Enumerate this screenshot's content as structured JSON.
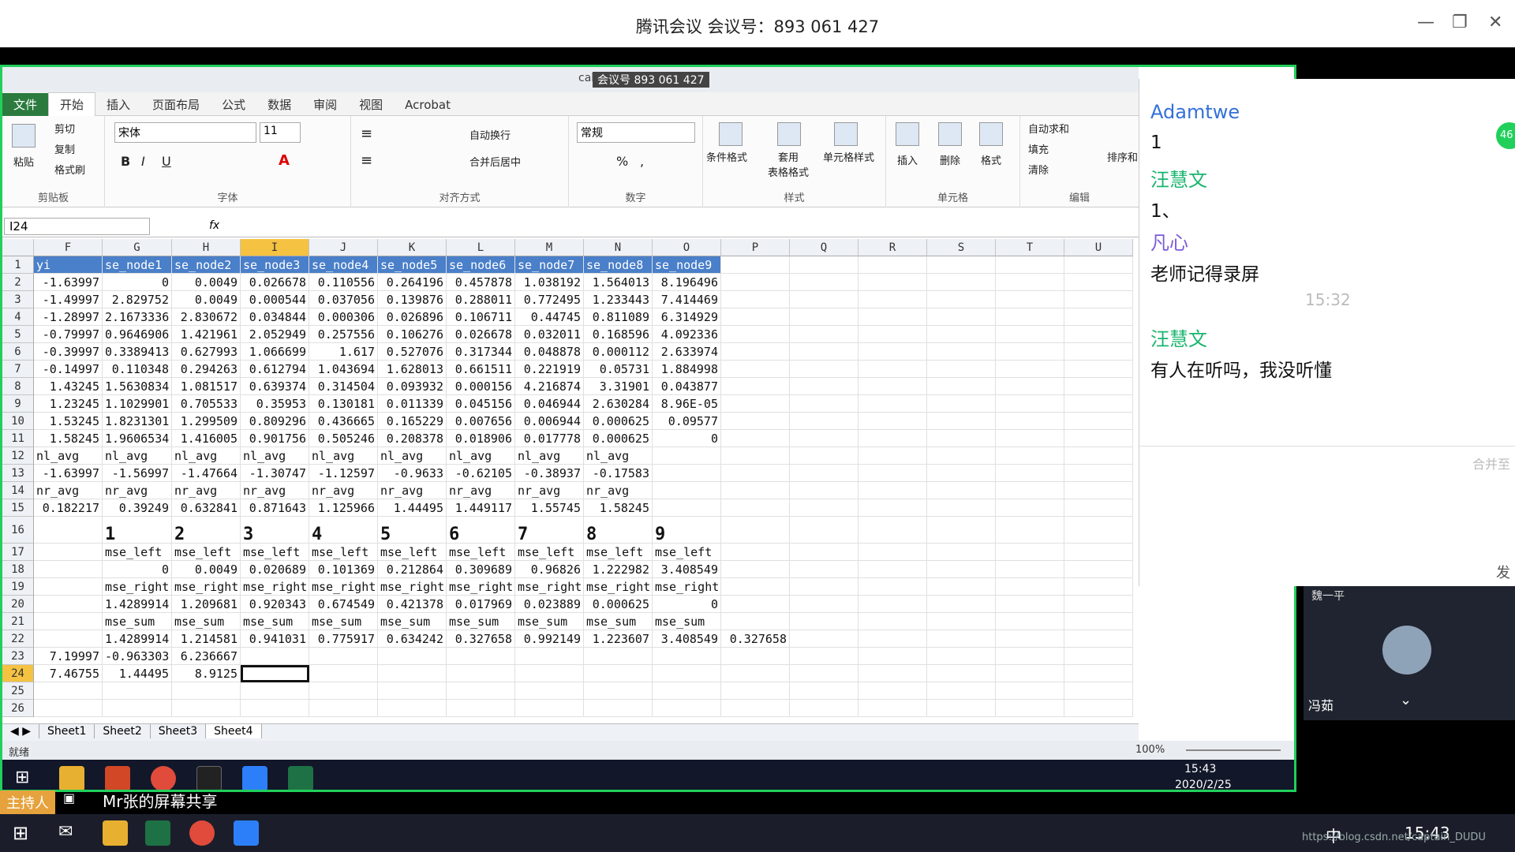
{
  "meeting": {
    "title": "腾讯会议 会议号：893 061 427",
    "minimize": "—",
    "restore": "❐",
    "close": "✕"
  },
  "excel": {
    "title_overlay": "会议号 893 061 427",
    "file_fragment": "cal...el",
    "tabs": [
      "文件",
      "开始",
      "插入",
      "页面布局",
      "公式",
      "数据",
      "审阅",
      "视图",
      "Acrobat"
    ],
    "clipboard": {
      "paste": "粘贴",
      "cut": "剪切",
      "copy": "复制",
      "format_painter": "格式刷",
      "label": "剪贴板"
    },
    "font": {
      "name": "宋体",
      "size": "11",
      "label": "字体",
      "bold": "B",
      "italic": "I",
      "underline": "U"
    },
    "align": {
      "wrap": "自动换行",
      "merge": "合并后居中",
      "label": "对齐方式"
    },
    "number": {
      "format": "常规",
      "label": "数字",
      "percent": "%",
      "comma": ","
    },
    "styles": {
      "cond": "条件格式",
      "table": "套用\n表格格式",
      "cell": "单元格样式",
      "label": "样式"
    },
    "cells": {
      "insert": "插入",
      "delete": "删除",
      "format": "格式",
      "label": "单元格"
    },
    "editing": {
      "autosum": "自动求和",
      "fill": "填充",
      "clear": "清除",
      "sort": "排序和",
      "label": "编辑"
    },
    "namebox": "I24",
    "fx": "fx",
    "columns": [
      "F",
      "G",
      "H",
      "I",
      "J",
      "K",
      "L",
      "M",
      "N",
      "O",
      "P",
      "Q",
      "R",
      "S",
      "T",
      "U"
    ],
    "rows": [
      [
        "yi",
        "se_node1",
        "se_node2",
        "se_node3",
        "se_node4",
        "se_node5",
        "se_node6",
        "se_node7",
        "se_node8",
        "se_node9"
      ],
      [
        "-1.63997",
        "0",
        "0.0049",
        "0.026678",
        "0.110556",
        "0.264196",
        "0.457878",
        "1.038192",
        "1.564013",
        "8.196496"
      ],
      [
        "-1.49997",
        "2.829752",
        "0.0049",
        "0.000544",
        "0.037056",
        "0.139876",
        "0.288011",
        "0.772495",
        "1.233443",
        "7.414469"
      ],
      [
        "-1.28997",
        "2.1673336",
        "2.830672",
        "0.034844",
        "0.000306",
        "0.026896",
        "0.106711",
        "0.44745",
        "0.811089",
        "6.314929"
      ],
      [
        "-0.79997",
        "0.9646906",
        "1.421961",
        "2.052949",
        "0.257556",
        "0.106276",
        "0.026678",
        "0.032011",
        "0.168596",
        "4.092336"
      ],
      [
        "-0.39997",
        "0.3389413",
        "0.627993",
        "1.066699",
        "1.617",
        "0.527076",
        "0.317344",
        "0.048878",
        "0.000112",
        "2.633974"
      ],
      [
        "-0.14997",
        "0.110348",
        "0.294263",
        "0.612794",
        "1.043694",
        "1.628013",
        "0.661511",
        "0.221919",
        "0.05731",
        "1.884998"
      ],
      [
        "1.43245",
        "1.5630834",
        "1.081517",
        "0.639374",
        "0.314504",
        "0.093932",
        "0.000156",
        "4.216874",
        "3.31901",
        "0.043877"
      ],
      [
        "1.23245",
        "1.1029901",
        "0.705533",
        "0.35953",
        "0.130181",
        "0.011339",
        "0.045156",
        "0.046944",
        "2.630284",
        "8.96E-05"
      ],
      [
        "1.53245",
        "1.8231301",
        "1.299509",
        "0.809296",
        "0.436665",
        "0.165229",
        "0.007656",
        "0.006944",
        "0.000625",
        "0.09577"
      ],
      [
        "1.58245",
        "1.9606534",
        "1.416005",
        "0.901756",
        "0.505246",
        "0.208378",
        "0.018906",
        "0.017778",
        "0.000625",
        "0"
      ],
      [
        "nl_avg",
        "nl_avg",
        "nl_avg",
        "nl_avg",
        "nl_avg",
        "nl_avg",
        "nl_avg",
        "nl_avg",
        "nl_avg",
        ""
      ],
      [
        "-1.63997",
        "-1.56997",
        "-1.47664",
        "-1.30747",
        "-1.12597",
        "-0.9633",
        "-0.62105",
        "-0.38937",
        "-0.17583",
        ""
      ],
      [
        "nr_avg",
        "nr_avg",
        "nr_avg",
        "nr_avg",
        "nr_avg",
        "nr_avg",
        "nr_avg",
        "nr_avg",
        "nr_avg",
        ""
      ],
      [
        "0.182217",
        "0.39249",
        "0.632841",
        "0.871643",
        "1.125966",
        "1.44495",
        "1.449117",
        "1.55745",
        "1.58245",
        ""
      ],
      [
        "",
        "1",
        "2",
        "3",
        "4",
        "5",
        "6",
        "7",
        "8",
        "9"
      ],
      [
        "",
        "mse_left",
        "mse_left",
        "mse_left",
        "mse_left",
        "mse_left",
        "mse_left",
        "mse_left",
        "mse_left",
        "mse_left"
      ],
      [
        "",
        "0",
        "0.0049",
        "0.020689",
        "0.101369",
        "0.212864",
        "0.309689",
        "0.96826",
        "1.222982",
        "3.408549"
      ],
      [
        "",
        "mse_right",
        "mse_right",
        "mse_right",
        "mse_right",
        "mse_right",
        "mse_right",
        "mse_right",
        "mse_right",
        "mse_right"
      ],
      [
        "",
        "1.4289914",
        "1.209681",
        "0.920343",
        "0.674549",
        "0.421378",
        "0.017969",
        "0.023889",
        "0.000625",
        "0"
      ],
      [
        "",
        "mse_sum",
        "mse_sum",
        "mse_sum",
        "mse_sum",
        "mse_sum",
        "mse_sum",
        "mse_sum",
        "mse_sum",
        "mse_sum"
      ],
      [
        "",
        "1.4289914",
        "1.214581",
        "0.941031",
        "0.775917",
        "0.634242",
        "0.327658",
        "0.992149",
        "1.223607",
        "3.408549",
        "0.327658"
      ],
      [
        "7.19997",
        "-0.963303",
        "6.236667",
        "",
        "",
        "",
        "",
        "",
        "",
        ""
      ],
      [
        "7.46755",
        "1.44495",
        "8.9125",
        "",
        "",
        "",
        "",
        "",
        "",
        ""
      ],
      [
        "",
        "",
        "",
        "",
        "",
        "",
        "",
        "",
        "",
        ""
      ],
      [
        "",
        "",
        "",
        "",
        "",
        "",
        "",
        "",
        "",
        ""
      ]
    ],
    "sheets": [
      "Sheet1",
      "Sheet2",
      "Sheet3",
      "Sheet4"
    ],
    "status": "就绪",
    "zoom": "100%",
    "clock_time": "15:43",
    "clock_date": "2020/2/25"
  },
  "chat": {
    "messages": [
      {
        "name": "Adamtwe",
        "text": "1",
        "color": "#3370d8"
      },
      {
        "name": "汪慧文",
        "text": "1、",
        "color": "#19b56f"
      },
      {
        "name": "凡心",
        "text": "老师记得录屏",
        "color": "#7a5ad8"
      },
      {
        "time": "15:32"
      },
      {
        "name": "汪慧文",
        "text": "有人在听吗，我没听懂",
        "color": "#19b56f"
      }
    ],
    "merge_label": "合并至",
    "send_label": "发",
    "badge": "46"
  },
  "video": {
    "name": "冯茹",
    "top_name": "魏一平"
  },
  "host": {
    "badge": "主持人",
    "share_text": "Mr张的屏幕共享"
  },
  "taskbar": {
    "time": "15:43",
    "ime": "中",
    "watermark": "https://blog.csdn.net/captain_DUDU"
  }
}
